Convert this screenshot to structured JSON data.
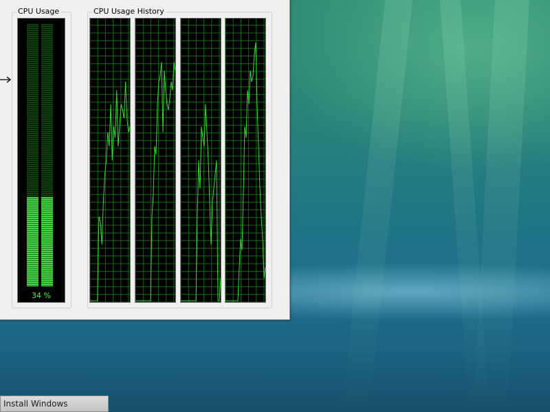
{
  "window": {
    "cpu_usage_title": "CPU Usage",
    "history_title": "CPU Usage History",
    "cpu_percent_text": "34 %",
    "cpu_usage_fraction": 0.34
  },
  "history": {
    "line_color": "#33dd33",
    "grid_color": "#0b6b0b",
    "cores": [
      {
        "values": [
          0,
          0,
          0,
          0,
          0,
          0,
          30,
          28,
          20,
          35,
          45,
          50,
          60,
          55,
          70,
          50,
          62,
          58,
          75,
          55,
          62,
          70,
          68,
          65,
          78,
          65,
          60,
          62
        ]
      },
      {
        "values": [
          0,
          0,
          0,
          0,
          0,
          0,
          0,
          0,
          0,
          0,
          0,
          0,
          30,
          38,
          55,
          52,
          70,
          78,
          80,
          85,
          60,
          82,
          75,
          70,
          68,
          72,
          78,
          75,
          85,
          82
        ]
      },
      {
        "values": [
          0,
          0,
          0,
          0,
          0,
          0,
          0,
          0,
          0,
          0,
          0,
          0,
          30,
          50,
          40,
          62,
          58,
          55,
          70,
          60,
          50,
          35,
          20,
          35,
          40,
          45,
          50,
          0,
          0,
          8
        ]
      },
      {
        "values": [
          0,
          0,
          0,
          0,
          0,
          0,
          0,
          0,
          0,
          0,
          12,
          22,
          18,
          38,
          62,
          58,
          75,
          70,
          82,
          78,
          80,
          88,
          92,
          70,
          55,
          40,
          30,
          22,
          8,
          12
        ]
      }
    ]
  },
  "taskbar": {
    "install_label": "Install Windows"
  }
}
